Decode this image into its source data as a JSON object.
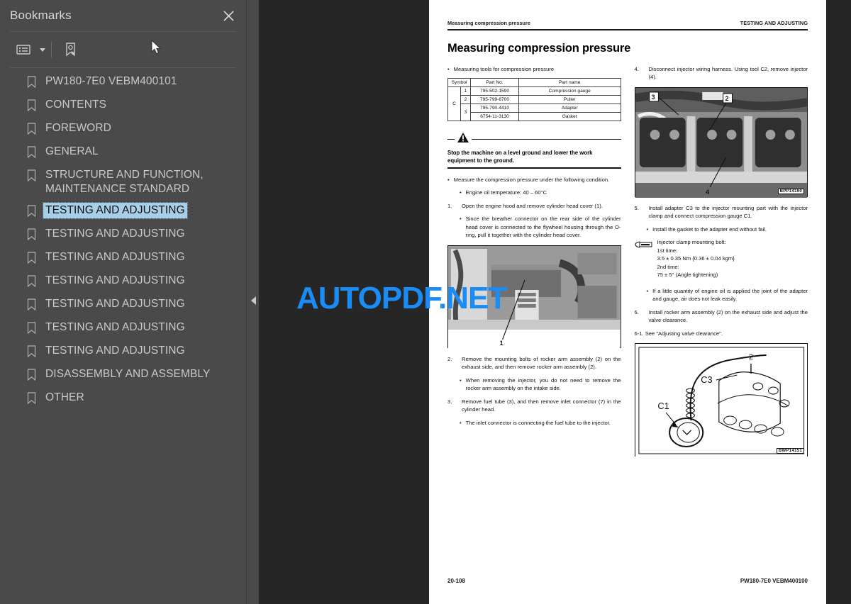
{
  "sidebar": {
    "title": "Bookmarks",
    "close_icon": "close-icon",
    "toolbar": {
      "list_view_icon": "list-options-icon",
      "dropdown_caret_icon": "chevron-down-icon",
      "new_bookmark_icon": "new-bookmark-icon"
    },
    "items": [
      {
        "label": "PW180-7E0    VEBM400101",
        "selected": false
      },
      {
        "label": "CONTENTS",
        "selected": false
      },
      {
        "label": "FOREWORD",
        "selected": false
      },
      {
        "label": "GENERAL",
        "selected": false
      },
      {
        "label": "STRUCTURE AND FUNCTION, MAINTENANCE STANDARD",
        "selected": false
      },
      {
        "label": "TESTING AND ADJUSTING",
        "selected": true
      },
      {
        "label": "TESTING AND ADJUSTING",
        "selected": false
      },
      {
        "label": "TESTING AND ADJUSTING",
        "selected": false
      },
      {
        "label": "TESTING AND ADJUSTING",
        "selected": false
      },
      {
        "label": "TESTING AND ADJUSTING",
        "selected": false
      },
      {
        "label": "TESTING AND ADJUSTING",
        "selected": false
      },
      {
        "label": "TESTING AND ADJUSTING",
        "selected": false
      },
      {
        "label": "DISASSEMBLY AND ASSEMBLY",
        "selected": false
      },
      {
        "label": "OTHER",
        "selected": false
      }
    ],
    "collapse_icon": "collapse-panel-icon",
    "highlight_color": "#a8cfe8",
    "background_color": "#4a4a4a"
  },
  "watermark": {
    "text": "AUTOPDF.NET",
    "color": "#1b8cf5"
  },
  "page": {
    "header": {
      "left": "Measuring compression pressure",
      "right": "TESTING AND ADJUSTING"
    },
    "title": "Measuring compression pressure",
    "left_column": {
      "tools_heading": "Measuring tools for compression pressure",
      "tools_table": {
        "headers": [
          "Symbol",
          "Part No.",
          "Part name"
        ],
        "symbol": "C",
        "rows": [
          {
            "no": "1",
            "part_no": "795-502-1590",
            "part_name": "Compression gauge"
          },
          {
            "no": "2",
            "part_no": "795-799-6700",
            "part_name": "Puller"
          },
          {
            "no": "3",
            "part_no": "795-790-4410",
            "part_name": "Adapter"
          },
          {
            "no": "",
            "part_no": "6754-11-3130",
            "part_name": "Gasket"
          }
        ]
      },
      "warning": {
        "icon": "warning-triangle-icon",
        "text": "Stop the machine on a level ground and lower the work equipment to the ground."
      },
      "blocks": [
        {
          "mark": "•",
          "text": "Measure the compression pressure under the following condition.",
          "indent": 0
        },
        {
          "mark": "•",
          "text": "Engine oil temperature: 40 – 60°C",
          "indent": 1
        },
        {
          "mark": "1.",
          "text": "Open the engine hood and remove cylinder head cover (1).",
          "indent": 0
        },
        {
          "mark": "•",
          "text": "Since the breather connector on the rear side of the cylinder head cover is connected to the flywheel housing through the O-ring, pull it together with the cylinder head cover.",
          "indent": 1
        }
      ],
      "figure": {
        "name": "engine-hood-photo",
        "callouts": [
          "1"
        ],
        "code": ""
      },
      "blocks2": [
        {
          "mark": "2.",
          "text": "Remove the mounting bolts of rocker arm assembly (2) on the exhaust side, and then remove rocker arm assembly (2).",
          "indent": 0
        },
        {
          "mark": "•",
          "text": "When removing the injector, you do not need to remove the rocker arm assembly on the intake side.",
          "indent": 1
        },
        {
          "mark": "3.",
          "text": "Remove fuel tube (3), and then remove inlet connector (7) in the cylinder head.",
          "indent": 0
        },
        {
          "mark": "•",
          "text": "The inlet connector is connecting the fuel tube to the injector.",
          "indent": 1
        }
      ]
    },
    "right_column": {
      "blocks": [
        {
          "mark": "4.",
          "text": "Disconnect injector wiring harness. Using tool C2, remove injector (4).",
          "indent": 0
        }
      ],
      "figure1": {
        "name": "cylinder-head-photo",
        "callouts": [
          "3",
          "2",
          "4"
        ],
        "code": "BPP14160"
      },
      "blocks2": [
        {
          "mark": "5.",
          "text": "Install adapter C3 to the injector mounting part with the injector clamp and connect compression gauge C1.",
          "indent": 0
        },
        {
          "mark": "•",
          "text": "Install the gasket to the adapter end without fail.",
          "indent": 1
        }
      ],
      "torque": {
        "icon": "torque-wrench-icon",
        "lines": [
          "Injector clamp mounting bolt:",
          "1st time:",
          "3.5 ± 0.35 Nm {0.36 ± 0.04 kgm}",
          "2nd time:",
          "75 ± 5° (Angle tightening)"
        ]
      },
      "blocks3": [
        {
          "mark": "•",
          "text": "If a little quantity of engine oil is applied the joint of the adapter and gauge, air does not leak easily.",
          "indent": 1
        },
        {
          "mark": "6.",
          "text": "Install rocker arm assembly (2) on the exhaust side and adjust the valve clearance.",
          "indent": 0
        }
      ],
      "see_also": "6-1. See \"Adjusting valve clearance\".",
      "figure2": {
        "name": "compression-gauge-diagram",
        "labels": [
          "C1",
          "C3",
          "2"
        ],
        "code": "BWP14151"
      }
    },
    "footer": {
      "left": "20-108",
      "right": "PW180-7E0   VEBM400100"
    }
  }
}
